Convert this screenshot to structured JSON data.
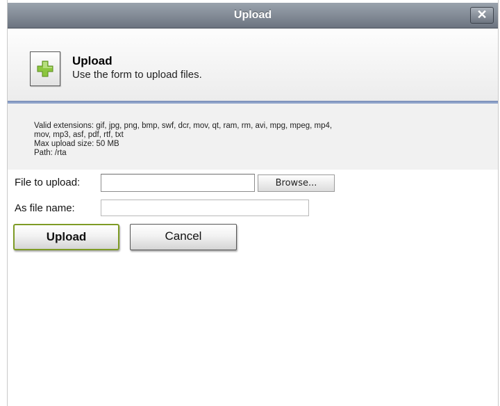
{
  "window": {
    "title": "Upload",
    "close_label": "✕"
  },
  "header": {
    "title": "Upload",
    "subtitle": "Use the form to upload files."
  },
  "info": {
    "extensions_line1": "Valid extensions: gif, jpg, png, bmp, swf, dcr, mov, qt, ram, rm, avi, mpg, mpeg, mp4,",
    "extensions_line2": "mov, mp3, asf, pdf, rtf, txt",
    "max_size": "Max upload size: 50 MB",
    "path": "Path: /rta"
  },
  "form": {
    "file_label": "File to upload:",
    "file_value": "",
    "browse_label": "Browse...",
    "filename_label": "As file name:",
    "filename_value": ""
  },
  "actions": {
    "upload_label": "Upload",
    "cancel_label": "Cancel"
  },
  "icons": {
    "header": "plus-icon",
    "close": "close-icon"
  },
  "colors": {
    "titlebar": "#7d8590",
    "accent_rule": "#8ea2c9",
    "upload_border": "#7e9b25",
    "plus_green": "#8cc63f"
  }
}
